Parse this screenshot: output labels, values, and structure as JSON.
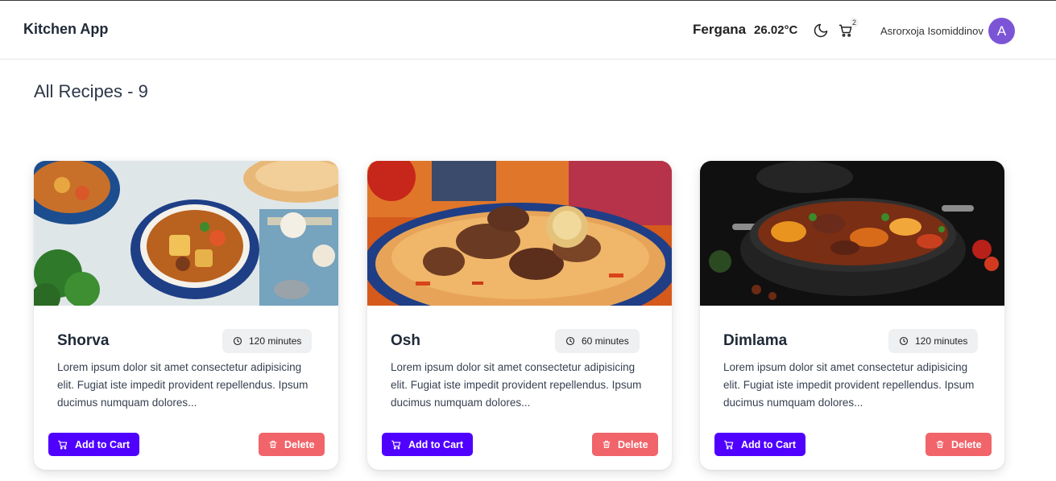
{
  "header": {
    "brand": "Kitchen App",
    "city": "Fergana",
    "temperature": "26.02°C",
    "theme_icon": "moon-icon",
    "cart_icon": "cart-icon",
    "cart_count": "2",
    "username": "Asrorxoja Isomiddinov",
    "avatar_letter": "A",
    "avatar_color": "#7c55d6"
  },
  "main": {
    "title": "All Recipes - 9"
  },
  "recipes": [
    {
      "title": "Shorva",
      "time": "120 minutes",
      "description": "Lorem ipsum dolor sit amet consectetur adipisicing elit. Fugiat iste impedit provident repellendus. Ipsum ducimus numquam dolores...",
      "add_label": "Add to Cart",
      "delete_label": "Delete",
      "image": "Shorva soup in blue ceramic bowls with bread and garlic"
    },
    {
      "title": "Osh",
      "time": "60 minutes",
      "description": "Lorem ipsum dolor sit amet consectetur adipisicing elit. Fugiat iste impedit provident repellendus. Ipsum ducimus numquam dolores...",
      "add_label": "Add to Cart",
      "delete_label": "Delete",
      "image": "Osh plov with meat and garlic on a blue plate"
    },
    {
      "title": "Dimlama",
      "time": "120 minutes",
      "description": "Lorem ipsum dolor sit amet consectetur adipisicing elit. Fugiat iste impedit provident repellendus. Ipsum ducimus numquam dolores...",
      "add_label": "Add to Cart",
      "delete_label": "Delete",
      "image": "Dimlama stew with vegetables in a dark pan"
    }
  ],
  "colors": {
    "primary_button": "#4f00ff",
    "danger_button": "#f0646a"
  }
}
